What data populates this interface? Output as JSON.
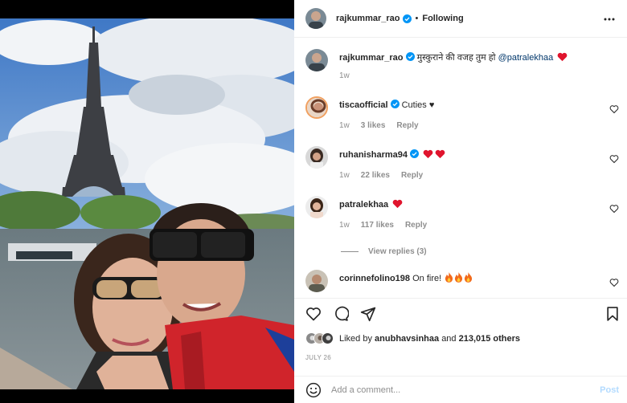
{
  "header": {
    "username": "rajkummar_rao",
    "separator": "•",
    "follow_status": "Following"
  },
  "caption": {
    "username": "rajkummar_rao",
    "text": "मुस्कुराने की वजह तुम हो",
    "mention": "@patralekhaa",
    "time": "1w"
  },
  "comments": [
    {
      "username": "tiscaofficial",
      "text": "Cuties ♥",
      "time": "1w",
      "likes": "3 likes",
      "reply": "Reply"
    },
    {
      "username": "ruhanisharma94",
      "text": "",
      "time": "1w",
      "likes": "22 likes",
      "reply": "Reply"
    },
    {
      "username": "patralekhaa",
      "text": "",
      "time": "1w",
      "likes": "117 likes",
      "reply": "Reply"
    },
    {
      "username": "corinnefolino198",
      "text": "On fire!",
      "time": "",
      "likes": "",
      "reply": ""
    }
  ],
  "view_replies": "View replies (3)",
  "likes_line": {
    "prefix": "Liked by",
    "user": "anubhavsinhaa",
    "middle": "and",
    "count": "213,015 others"
  },
  "date": "JULY 26",
  "add_comment": {
    "placeholder": "Add a comment...",
    "post_label": "Post"
  },
  "colors": {
    "verified": "#0095f6",
    "heart_red": "#ed4956",
    "post_disabled": "#b3dbff",
    "secondary_text": "#8e8e8e"
  },
  "icons": [
    "more-options-icon",
    "verified-badge-icon",
    "like-icon",
    "comment-icon",
    "share-icon",
    "save-icon",
    "emoji-icon",
    "red-heart-emoji",
    "fire-emoji"
  ]
}
